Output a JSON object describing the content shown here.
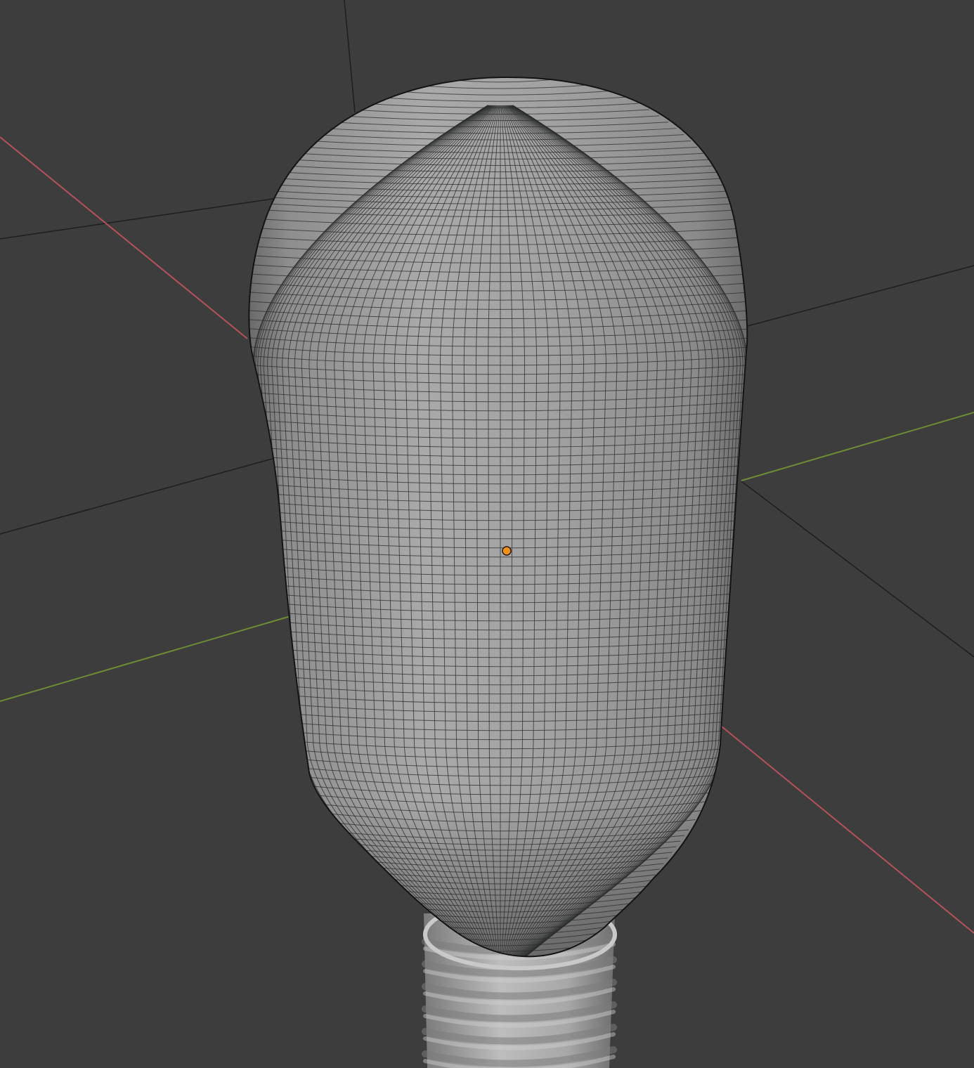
{
  "viewport": {
    "view": "3d-viewport",
    "shading": "solid-wireframe",
    "background_color": "#3d3d3d"
  },
  "colors": {
    "x_axis": "#b5525c",
    "y_axis": "#6e8c35",
    "grid_line": "#1f1f1f",
    "mesh_fill": "#a3a3a3",
    "mesh_wire": "#2b2d2c",
    "origin_point": "#f0901e"
  },
  "scene": {
    "object": "light-bulb-mesh",
    "parts": [
      "glass-bulb",
      "screw-base"
    ],
    "origin_marker": "object-origin"
  }
}
